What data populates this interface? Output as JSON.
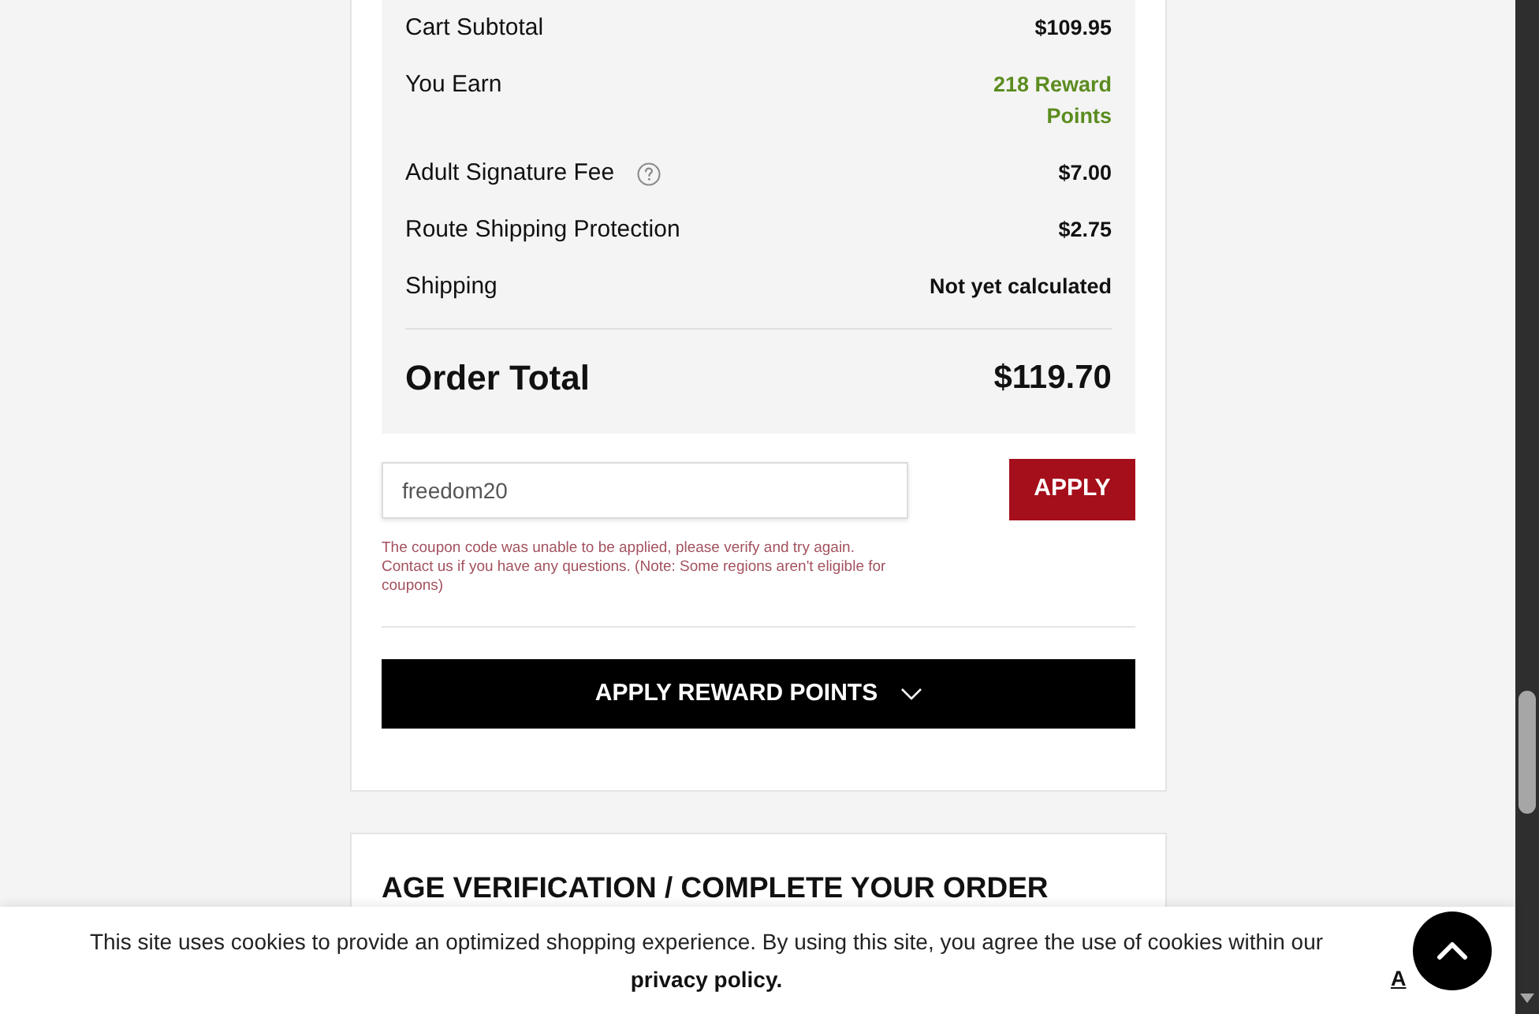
{
  "order_summary": {
    "rows": [
      {
        "label": "Cart Subtotal",
        "value": "$109.95",
        "kind": "amount",
        "help": false
      },
      {
        "label": "You Earn",
        "value": "218 Reward Points",
        "kind": "reward",
        "help": false
      },
      {
        "label": "Adult Signature Fee",
        "value": "$7.00",
        "kind": "amount",
        "help": true
      },
      {
        "label": "Route Shipping Protection",
        "value": "$2.75",
        "kind": "amount",
        "help": false
      },
      {
        "label": "Shipping",
        "value": "Not yet calculated",
        "kind": "amount",
        "help": false
      }
    ],
    "total": {
      "label": "Order Total",
      "value": "$119.70"
    }
  },
  "coupon": {
    "value": "freedom20",
    "button": "APPLY",
    "error": "The coupon code was unable to be applied, please verify and try again. Contact us if you have any questions. (Note: Some regions aren't eligible for coupons)"
  },
  "reward_points_button": {
    "label": "APPLY REWARD POINTS",
    "expanded": false
  },
  "age_verification_section": {
    "title": "AGE VERIFICATION / COMPLETE YOUR ORDER"
  },
  "cookie_banner": {
    "message": "This site uses cookies to provide an optimized shopping experience. By using this site, you agree the use of cookies within our",
    "link": "privacy policy.",
    "accept": "A"
  }
}
